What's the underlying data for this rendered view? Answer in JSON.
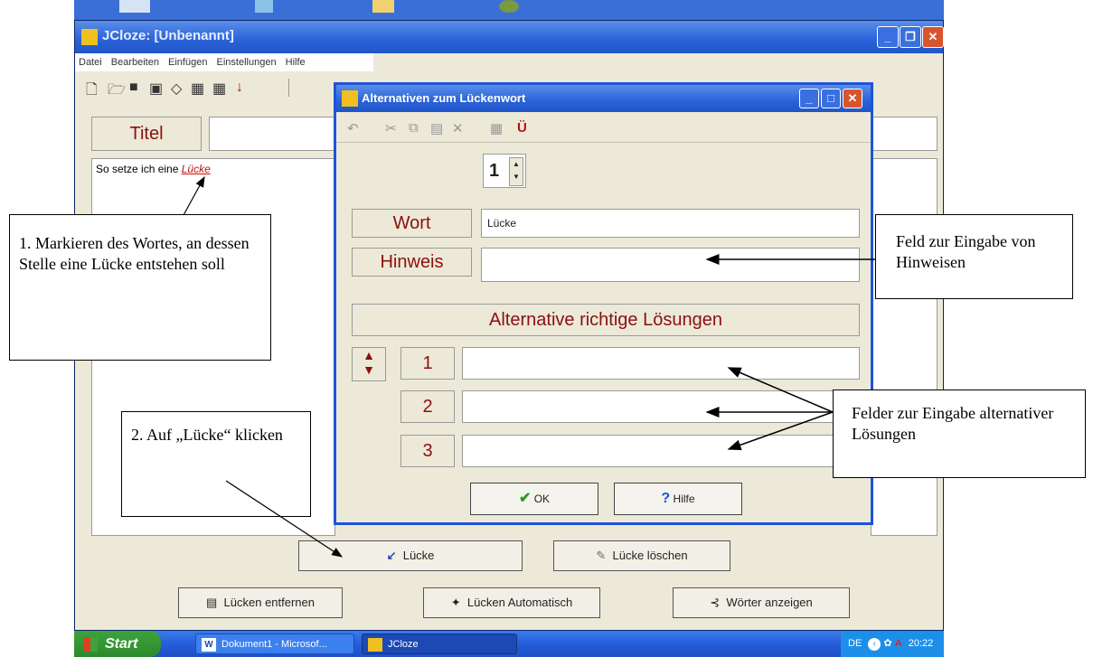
{
  "main_window": {
    "title": "JCloze: [Unbenannt]",
    "menu": [
      "Datei",
      "Bearbeiten",
      "Einfügen",
      "Einstellungen",
      "Hilfe"
    ],
    "title_label": "Titel",
    "editor_text": "So setze ich eine",
    "editor_gap_word": "Lücke",
    "buttons": {
      "luecke": "Lücke",
      "luecke_loeschen": "Lücke löschen",
      "luecken_entfernen": "Lücken entfernen",
      "luecken_automatisch": "Lücken Automatisch",
      "woerter_anzeigen": "Wörter anzeigen"
    }
  },
  "dialog": {
    "title": "Alternativen zum Lückenwort",
    "spinner_value": "1",
    "word_label": "Wort",
    "word_value": "Lücke",
    "hint_label": "Hinweis",
    "hint_value": "",
    "alternatives_header": "Alternative richtige Lösungen",
    "alternatives": [
      {
        "number": "1",
        "value": ""
      },
      {
        "number": "2",
        "value": ""
      },
      {
        "number": "3",
        "value": ""
      }
    ],
    "ok_label": "OK",
    "help_label": "Hilfe"
  },
  "callouts": {
    "step1": "1. Markieren des Wortes, an dessen Stelle eine Lücke entstehen soll",
    "step2": "2. Auf „Lücke“ klicken",
    "hint_field": "Feld zur Eingabe von Hinweisen",
    "alt_fields": "Felder zur Eingabe alternativer Lösungen"
  },
  "taskbar": {
    "start": "Start",
    "tasks": [
      "Dokument1 - Microsof...",
      "JCloze"
    ],
    "language": "DE",
    "clock": "20:22"
  },
  "colors": {
    "label_red": "#8b1010",
    "titlebar_blue": "#2a62d8",
    "window_bg": "#ece9d8"
  }
}
